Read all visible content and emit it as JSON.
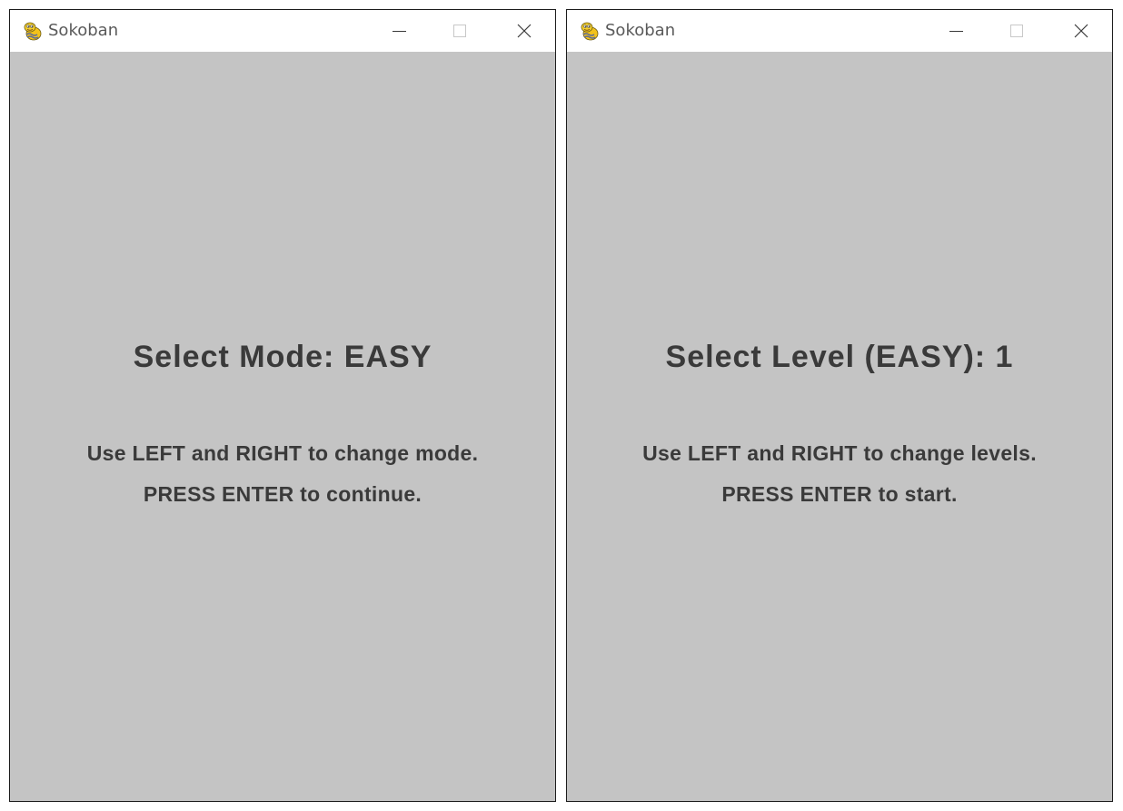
{
  "windows": [
    {
      "title": "Sokoban",
      "heading": "Select Mode: EASY",
      "instruction_1": "Use LEFT and RIGHT to change mode.",
      "instruction_2": "PRESS ENTER to continue."
    },
    {
      "title": "Sokoban",
      "heading": "Select Level (EASY): 1",
      "instruction_1": "Use LEFT and RIGHT to change levels.",
      "instruction_2": "PRESS ENTER to start."
    }
  ],
  "icons": {
    "app": "pygame-snake-icon",
    "minimize": "minimize-icon",
    "maximize": "maximize-icon",
    "close": "close-icon"
  },
  "colors": {
    "canvas_background": "#c4c4c4",
    "text": "#3a3a3a",
    "titlebar": "#ffffff",
    "title_text": "#5a5a5a"
  }
}
